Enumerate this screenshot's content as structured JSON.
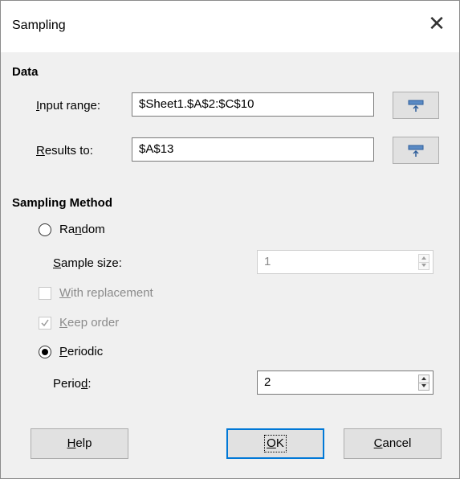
{
  "dialog": {
    "title": "Sampling",
    "close_glyph": "✕"
  },
  "data_section": {
    "heading": "Data",
    "input_range": {
      "label_key": "I",
      "label_rest": "nput range:",
      "value": "$Sheet1.$A$2:$C$10"
    },
    "results_to": {
      "label_key": "R",
      "label_rest": "esults to:",
      "value": "$A$13"
    },
    "shrink_icon": "shrink-icon"
  },
  "method_section": {
    "heading": "Sampling Method",
    "random": {
      "label_pre": "Ra",
      "label_key": "n",
      "label_post": "dom",
      "selected": false
    },
    "sample_size": {
      "label_key": "S",
      "label_rest": "ample size:",
      "value": "1",
      "enabled": false
    },
    "with_replacement": {
      "label_key": "W",
      "label_rest": "ith replacement",
      "checked": false,
      "enabled": false
    },
    "keep_order": {
      "label_key": "K",
      "label_rest": "eep order",
      "checked": true,
      "enabled": false
    },
    "periodic": {
      "label_key": "P",
      "label_rest": "eriodic",
      "selected": true
    },
    "period": {
      "label_pre": "Perio",
      "label_key": "d",
      "label_post": ":",
      "value": "2",
      "enabled": true
    }
  },
  "buttons": {
    "help": {
      "key": "H",
      "rest": "elp"
    },
    "ok": {
      "key": "O",
      "rest": "K"
    },
    "cancel": {
      "key": "C",
      "rest": "ancel"
    }
  },
  "colors": {
    "accent": "#0078d7",
    "dialog_bg": "#f0f0f0",
    "button_bg": "#e1e1e1"
  }
}
